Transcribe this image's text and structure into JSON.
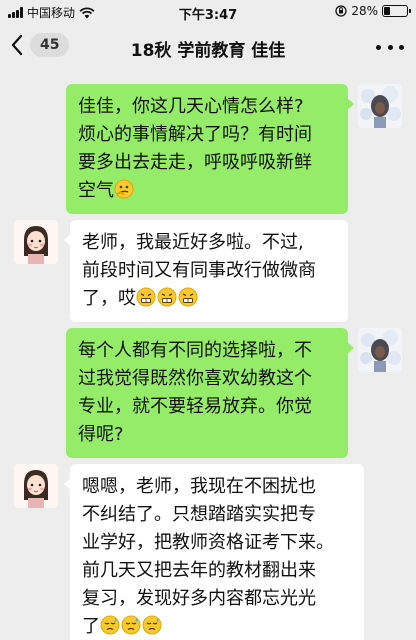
{
  "status_bar": {
    "carrier": "中国移动",
    "time": "下午3:47",
    "battery_percent": 28,
    "battery_label": "28%"
  },
  "nav": {
    "unread_count": "45",
    "title": "18秋 学前教育 佳佳"
  },
  "colors": {
    "background": "#ededed",
    "outgoing_bubble": "#95ec69",
    "incoming_bubble": "#ffffff"
  },
  "messages": [
    {
      "direction": "outgoing",
      "lines": [
        "佳佳，你这几天心情怎么样?",
        "烦心的事情解决了吗？有时间",
        "要多出去走走，呼吸呼吸新鲜",
        "空气"
      ],
      "emojis": [
        "thinking-emoji"
      ]
    },
    {
      "direction": "incoming",
      "lines": [
        "老师，我最近好多啦。不过,",
        "前段时间又有同事改行做微商",
        "了，哎"
      ],
      "emojis": [
        "grimace-emoji",
        "grimace-emoji",
        "grimace-emoji"
      ]
    },
    {
      "direction": "outgoing",
      "lines": [
        "每个人都有不同的选择啦，不",
        "过我觉得既然你喜欢幼教这个",
        "专业，就不要轻易放弃。你觉",
        "得呢?"
      ],
      "emojis": []
    },
    {
      "direction": "incoming",
      "lines": [
        "嗯嗯，老师，我现在不困扰也",
        "不纠结了。只想踏踏实实把专",
        "业学好，把教师资格证考下来。",
        "前几天又把去年的教材翻出来",
        "复习，发现好多内容都忘光光",
        "了"
      ],
      "emojis": [
        "sweat-emoji",
        "sweat-emoji",
        "sweat-emoji"
      ]
    }
  ]
}
